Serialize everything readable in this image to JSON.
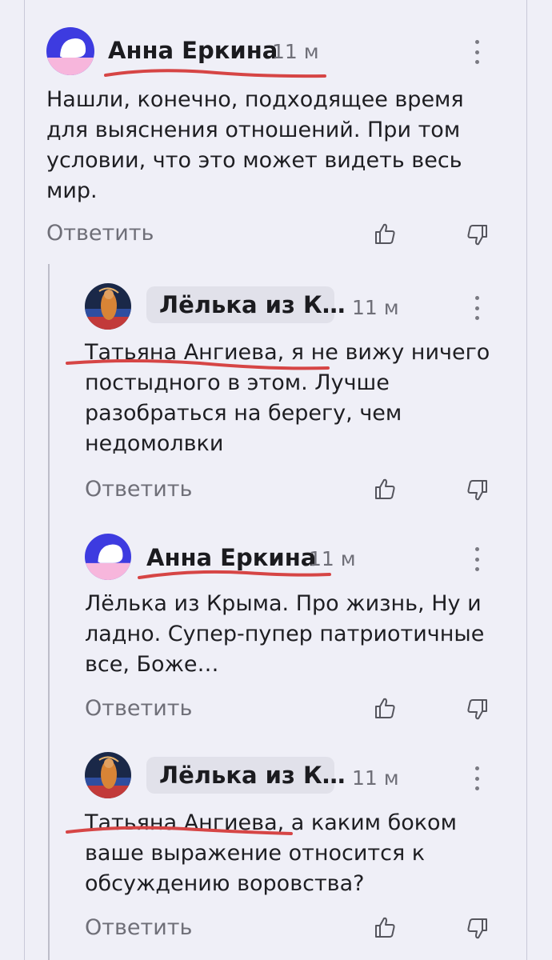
{
  "comments": [
    {
      "author": "Анна Еркина",
      "time": "11 м",
      "text_lines": [
        "Нашли, конечно, подходящее время",
        "для выяснения отношений. При том",
        "условии, что это может видеть весь",
        "мир."
      ],
      "reply_label": "Ответить"
    },
    {
      "author": "Лёлька из К…",
      "time": "11 м",
      "text_lines": [
        "Татьяна Ангиева, я не вижу ничего",
        "постыдного в этом. Лучше",
        "разобраться на берегу, чем",
        "недомолвки"
      ],
      "reply_label": "Ответить"
    },
    {
      "author": "Анна Еркина",
      "time": "11 м",
      "text_lines": [
        "Лёлька из Крыма. Про жизнь, Ну и",
        "ладно. Супер-пупер патриотичные",
        "все, Боже…"
      ],
      "reply_label": "Ответить"
    },
    {
      "author": "Лёлька из К…",
      "time": "11 м",
      "text_lines": [
        "Татьяна Ангиева, а каким боком",
        "ваше выражение относится к",
        "обсуждению воровства?"
      ],
      "reply_label": "Ответить"
    }
  ],
  "icons": {
    "like": "thumbs-up-icon",
    "dislike": "thumbs-down-icon",
    "more": "more-vertical-icon"
  },
  "colors": {
    "background": "#efeff7",
    "annotation": "#d64545",
    "avatar_blue": "#3d3be0",
    "avatar_pink": "#f7b6dc"
  }
}
